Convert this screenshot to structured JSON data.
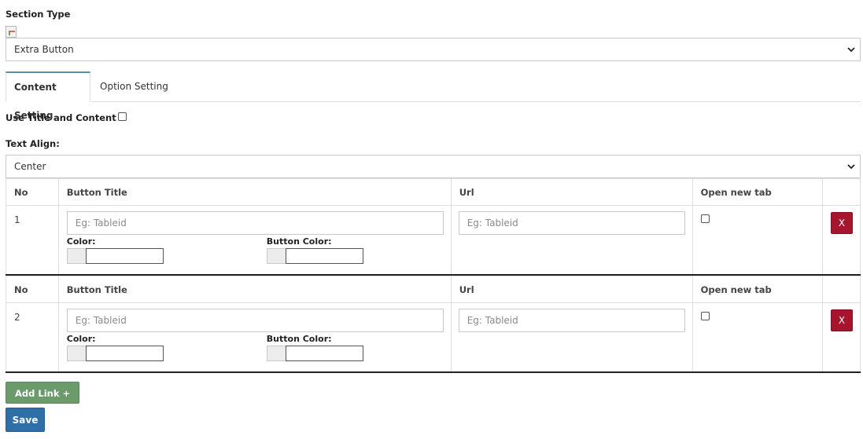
{
  "section_type": {
    "label": "Section Type",
    "selected": "Extra Button"
  },
  "tabs": [
    {
      "label": "Content Setting",
      "active": true
    },
    {
      "label": "Option Setting",
      "active": false
    }
  ],
  "use_title_content": {
    "label": "Use Title and Content",
    "checked": false
  },
  "text_align": {
    "label": "Text Align:",
    "selected": "Center"
  },
  "link_table": {
    "headers": [
      "No",
      "Button Title",
      "Url",
      "Open new tab"
    ],
    "color_label": "Color:",
    "button_color_label": "Button Color:",
    "rows": [
      {
        "no": "1",
        "title_placeholder": "Eg: Tableid",
        "url_placeholder": "Eg: Tableid",
        "open_new_tab": false,
        "delete_label": "X"
      },
      {
        "no": "2",
        "title_placeholder": "Eg: Tableid",
        "url_placeholder": "Eg: Tableid",
        "open_new_tab": false,
        "delete_label": "X"
      }
    ]
  },
  "buttons": {
    "add_link": "Add Link +",
    "save": "Save"
  },
  "colors": {
    "delete": "#a6142d",
    "add_link": "#6b9b6b",
    "save": "#2f6fa7",
    "tab_accent": "#5a8fa8"
  }
}
